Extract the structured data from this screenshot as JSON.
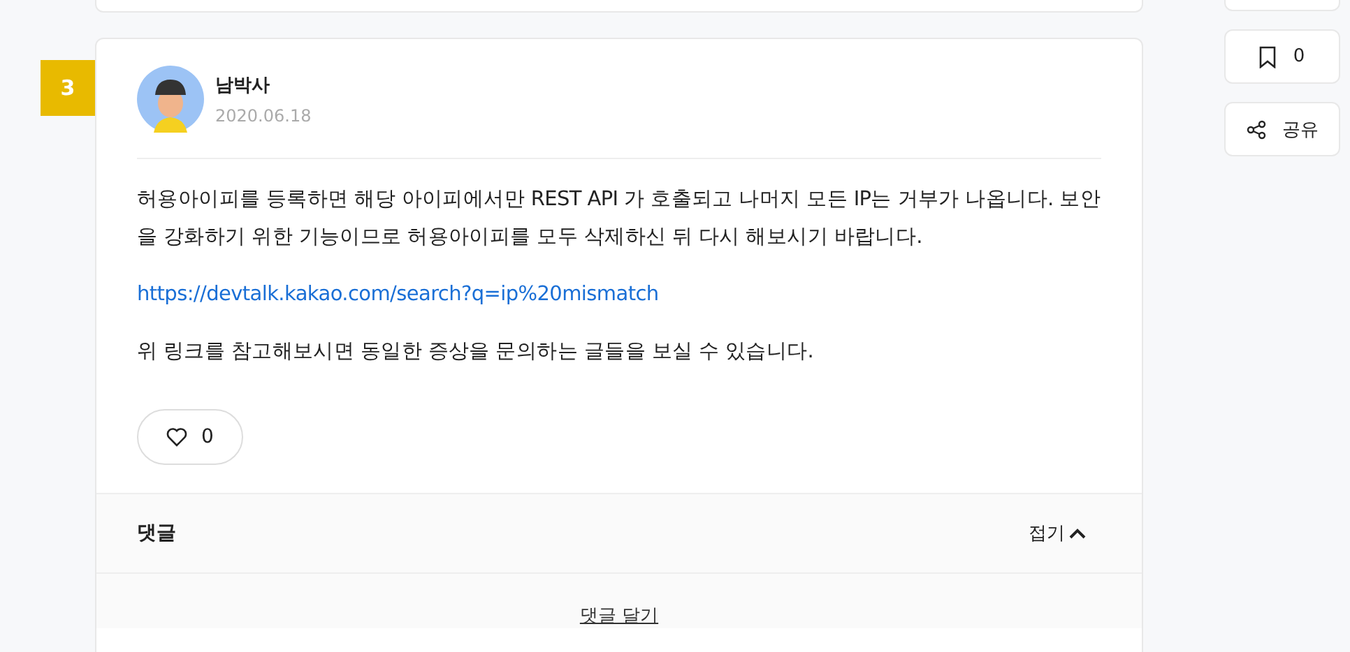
{
  "answer": {
    "number": "3",
    "author": "남박사",
    "date": "2020.06.18",
    "body": [
      {
        "kind": "text",
        "text": "허용아이피를 등록하면 해당 아이피에서만 REST API 가 호출되고 나머지 모든 IP는 거부가 나옵니다. 보안을 강화하기 위한 기능이므로 허용아이피를 모두 삭제하신 뒤 다시 해보시기 바랍니다."
      },
      {
        "kind": "link",
        "text": "https://devtalk.kakao.com/search?q=ip%20mismatch"
      },
      {
        "kind": "text",
        "text": "위 링크를 참고해보시면 동일한 증상을 문의하는 글들을 보실 수 있습니다."
      }
    ],
    "likes": "0"
  },
  "comments": {
    "title": "댓글",
    "toggle": "접기",
    "expanded": true,
    "add": "댓글 달기"
  },
  "sidebar": {
    "bookmarks": "0",
    "share": "공유"
  }
}
